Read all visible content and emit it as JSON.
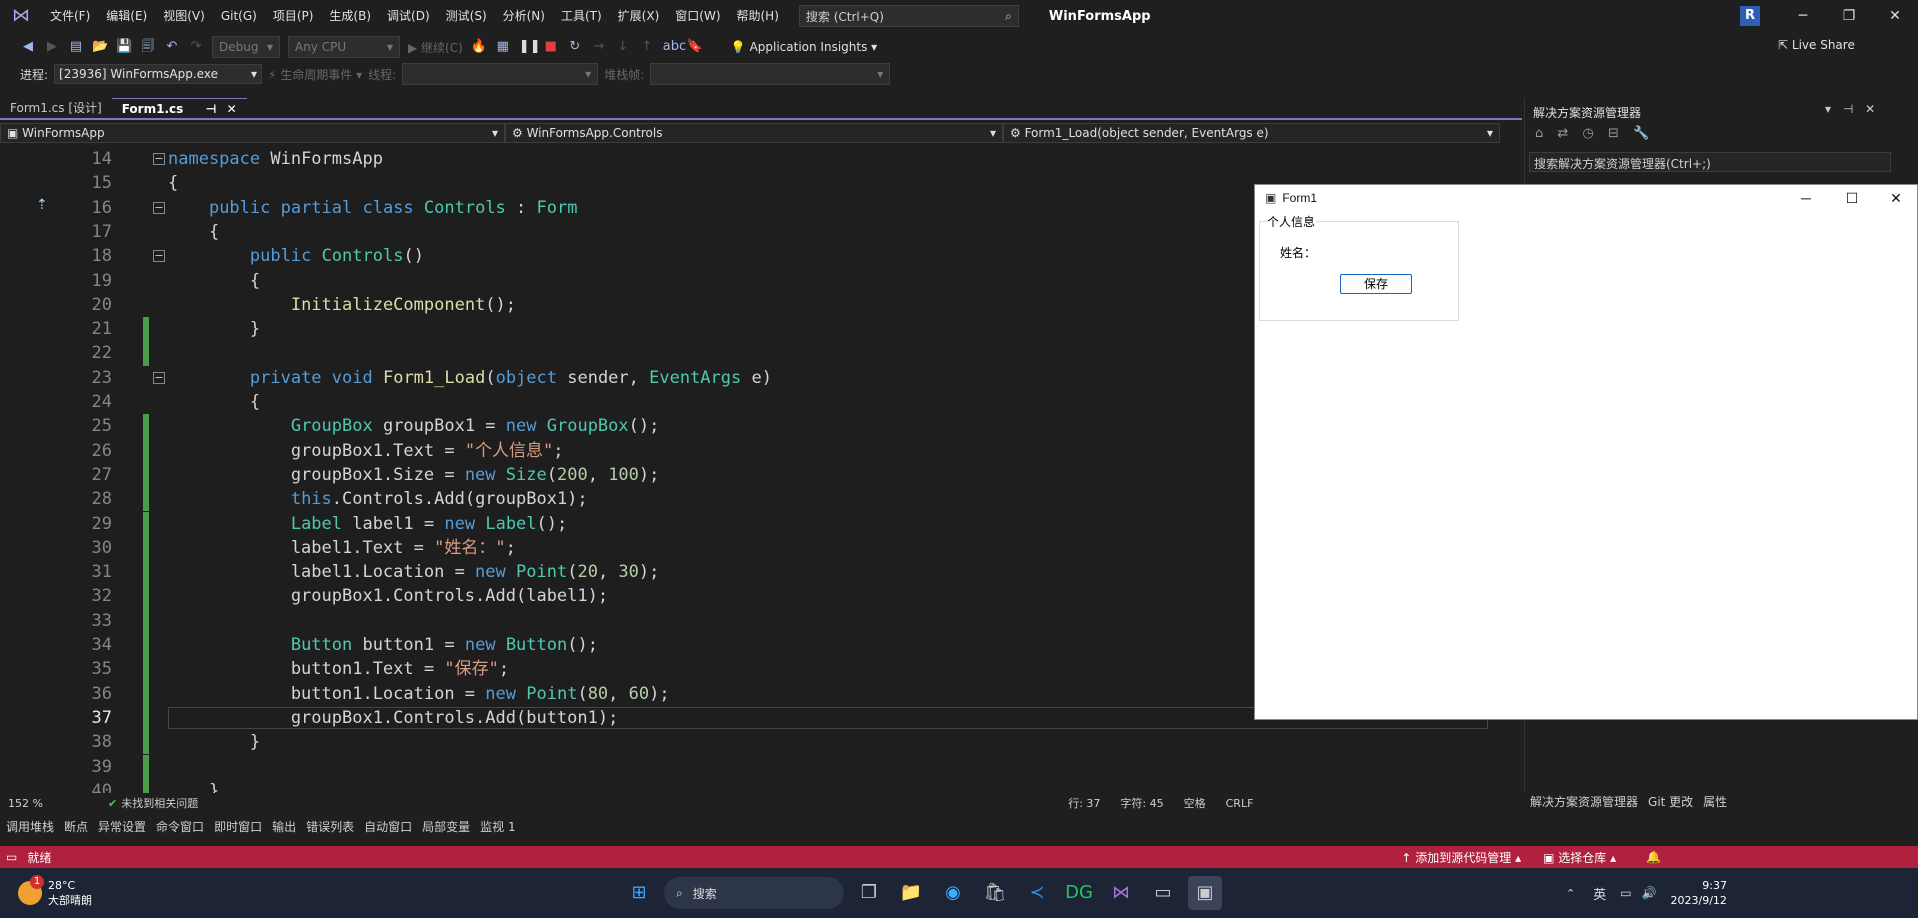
{
  "menu": {
    "items": [
      "文件(F)",
      "编辑(E)",
      "视图(V)",
      "Git(G)",
      "项目(P)",
      "生成(B)",
      "调试(D)",
      "测试(S)",
      "分析(N)",
      "工具(T)",
      "扩展(X)",
      "窗口(W)",
      "帮助(H)"
    ],
    "search_placeholder": "搜索 (Ctrl+Q)",
    "app_name": "WinFormsApp",
    "avatar_initial": "R"
  },
  "toolbar": {
    "config": "Debug",
    "platform": "Any CPU",
    "continue": "继续(C)",
    "app_insights": "Application Insights",
    "live_share": "Live Share"
  },
  "debugbar": {
    "process_label": "进程:",
    "process_value": "[23936] WinFormsApp.exe",
    "lifecycle": "生命周期事件",
    "thread": "线程:",
    "stackframe": "堆栈帧:"
  },
  "doc_tabs": [
    "Form1.cs [设计]",
    "Form1.cs"
  ],
  "navbar": {
    "project": "WinFormsApp",
    "type": "WinFormsApp.Controls",
    "member": "Form1_Load(object sender, EventArgs e)"
  },
  "editor": {
    "current_line": 37,
    "lines": [
      {
        "n": 14,
        "fold": true,
        "html": "<span class=\"kw\">namespace</span> WinFormsApp"
      },
      {
        "n": 15,
        "html": "{"
      },
      {
        "n": 16,
        "fold": true,
        "html": "    <span class=\"kw\">public partial class</span> <span class=\"ty\">Controls</span> : <span class=\"ty\">Form</span>"
      },
      {
        "n": 17,
        "html": "    {"
      },
      {
        "n": 18,
        "fold": true,
        "html": "        <span class=\"kw\">public</span> <span class=\"ty\">Controls</span>()"
      },
      {
        "n": 19,
        "html": "        {"
      },
      {
        "n": 20,
        "html": "            <span class=\"fn\">InitializeComponent</span>();"
      },
      {
        "n": 21,
        "changed": true,
        "html": "        }"
      },
      {
        "n": 22,
        "changed": true,
        "html": ""
      },
      {
        "n": 23,
        "fold": true,
        "html": "        <span class=\"kw\">private void</span> <span class=\"fn\">Form1_Load</span>(<span class=\"kw\">object</span> sender, <span class=\"ty\">EventArgs</span> e)"
      },
      {
        "n": 24,
        "html": "        {"
      },
      {
        "n": 25,
        "changed": true,
        "html": "            <span class=\"ty\">GroupBox</span> groupBox1 = <span class=\"kw\">new</span> <span class=\"ty\">GroupBox</span>();"
      },
      {
        "n": 26,
        "changed": true,
        "html": "            groupBox1.Text = <span class=\"st\">\"个人信息\"</span>;"
      },
      {
        "n": 27,
        "changed": true,
        "html": "            groupBox1.Size = <span class=\"kw\">new</span> <span class=\"ty\">Size</span>(<span class=\"num\">200</span>, <span class=\"num\">100</span>);"
      },
      {
        "n": 28,
        "changed": true,
        "html": "            <span class=\"kw\">this</span>.Controls.Add(groupBox1);"
      },
      {
        "n": 29,
        "changed": true,
        "html": "            <span class=\"ty\">Label</span> label1 = <span class=\"kw\">new</span> <span class=\"ty\">Label</span>();"
      },
      {
        "n": 30,
        "changed": true,
        "html": "            label1.Text = <span class=\"st\">\"姓名：\"</span>;"
      },
      {
        "n": 31,
        "changed": true,
        "html": "            label1.Location = <span class=\"kw\">new</span> <span class=\"ty\">Point</span>(<span class=\"num\">20</span>, <span class=\"num\">30</span>);"
      },
      {
        "n": 32,
        "changed": true,
        "html": "            groupBox1.Controls.Add(label1);"
      },
      {
        "n": 33,
        "changed": true,
        "html": ""
      },
      {
        "n": 34,
        "changed": true,
        "html": "            <span class=\"ty\">Button</span> button1 = <span class=\"kw\">new</span> <span class=\"ty\">Button</span>();"
      },
      {
        "n": 35,
        "changed": true,
        "html": "            button1.Text = <span class=\"st\">\"保存\"</span>;"
      },
      {
        "n": 36,
        "changed": true,
        "html": "            button1.Location = <span class=\"kw\">new</span> <span class=\"ty\">Point</span>(<span class=\"num\">80</span>, <span class=\"num\">60</span>);"
      },
      {
        "n": 37,
        "changed": true,
        "html": "            groupBox1.Controls.Add(button1);"
      },
      {
        "n": 38,
        "changed": true,
        "html": "        }"
      },
      {
        "n": 39,
        "changed": true,
        "html": ""
      },
      {
        "n": 40,
        "changed": true,
        "html": "    }"
      }
    ]
  },
  "edstatus": {
    "zoom": "152 %",
    "issues": "未找到相关问题",
    "line": "行: 37",
    "char": "字符: 45",
    "spaces": "空格",
    "eol": "CRLF"
  },
  "tool_tabs": [
    "调用堆栈",
    "断点",
    "异常设置",
    "命令窗口",
    "即时窗口",
    "输出",
    "错误列表",
    "自动窗口",
    "局部变量",
    "监视 1"
  ],
  "solution_explorer": {
    "title": "解决方案资源管理器",
    "search": "搜索解决方案资源管理器(Ctrl+;)",
    "bottom_tabs": [
      "解决方案资源管理器",
      "Git 更改",
      "属性"
    ]
  },
  "statusbar": {
    "ready": "就绪",
    "add_source": "添加到源代码管理",
    "select_repo": "选择仓库"
  },
  "form1": {
    "title": "Form1",
    "groupbox_text": "个人信息",
    "label_text": "姓名：",
    "button_text": "保存"
  },
  "taskbar": {
    "weather_temp": "28°C",
    "weather_desc": "大部晴朗",
    "weather_badge": "1",
    "search": "搜索",
    "ime": "英",
    "time": "9:37",
    "date": "2023/9/12"
  },
  "colors": {
    "accent": "#8a72c8",
    "status_bar": "#b0213f",
    "change_marker": "#4c9a4c"
  }
}
